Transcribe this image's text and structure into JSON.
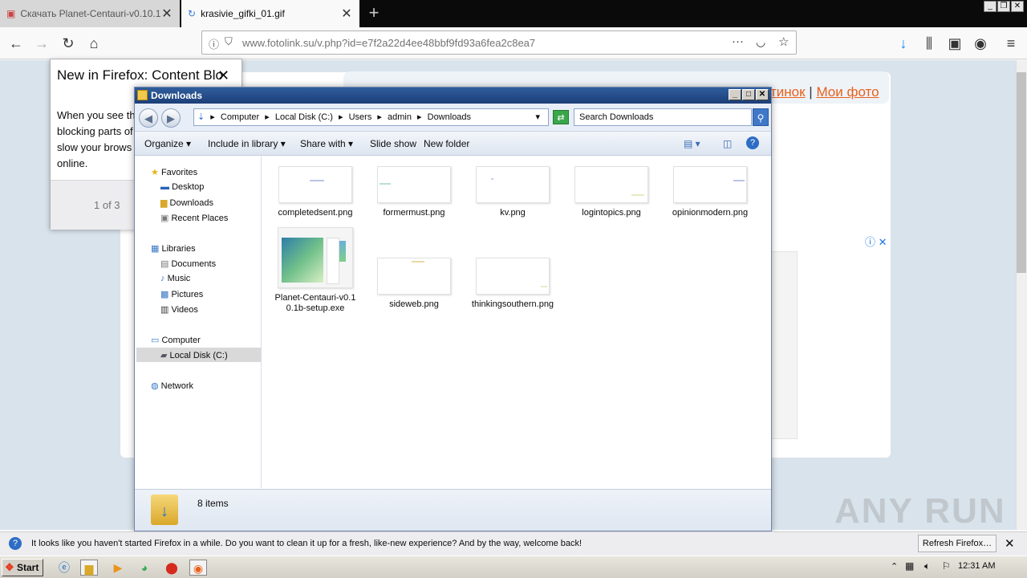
{
  "browser": {
    "tabs": [
      {
        "label": "Скачать Planet-Centauri-v0.10.1"
      },
      {
        "label": "krasivie_gifki_01.gif"
      }
    ],
    "url": "www.fotolink.su/v.php?id=e7f2a22d4ee48bbf9fd93a6fea2c8ea7"
  },
  "page": {
    "links": [
      "тинок",
      "Мои фото"
    ],
    "separator": "|"
  },
  "ff_panel": {
    "title": "New in Firefox: Content Blo",
    "body": "When you see th blocking parts of slow your brows online.",
    "pager": "1 of 3"
  },
  "explorer": {
    "title": "Downloads",
    "breadcrumb": [
      "Computer",
      "Local Disk (C:)",
      "Users",
      "admin",
      "Downloads"
    ],
    "search_placeholder": "Search Downloads",
    "toolbar": {
      "organize": "Organize",
      "include": "Include in library",
      "share": "Share with",
      "slideshow": "Slide show",
      "newfolder": "New folder"
    },
    "nav": {
      "favorites": "Favorites",
      "desktop": "Desktop",
      "downloads": "Downloads",
      "recent": "Recent Places",
      "libraries": "Libraries",
      "documents": "Documents",
      "music": "Music",
      "pictures": "Pictures",
      "videos": "Videos",
      "computer": "Computer",
      "localdisk": "Local Disk (C:)",
      "network": "Network"
    },
    "files": [
      {
        "name": "completedsent.png"
      },
      {
        "name": "formermust.png"
      },
      {
        "name": "kv.png"
      },
      {
        "name": "logintopics.png"
      },
      {
        "name": "opinionmodern.png"
      },
      {
        "name": "Planet-Centauri-v0.10.1b-setup.exe"
      },
      {
        "name": "sideweb.png"
      },
      {
        "name": "thinkingsouthern.png"
      }
    ],
    "status": "8 items"
  },
  "notification": {
    "message": "It looks like you haven't started Firefox in a while. Do you want to clean it up for a fresh, like-new experience? And by the way, welcome back!",
    "button": "Refresh Firefox…"
  },
  "taskbar": {
    "start": "Start",
    "clock": "12:31 AM"
  },
  "watermark": "ANY RUN"
}
